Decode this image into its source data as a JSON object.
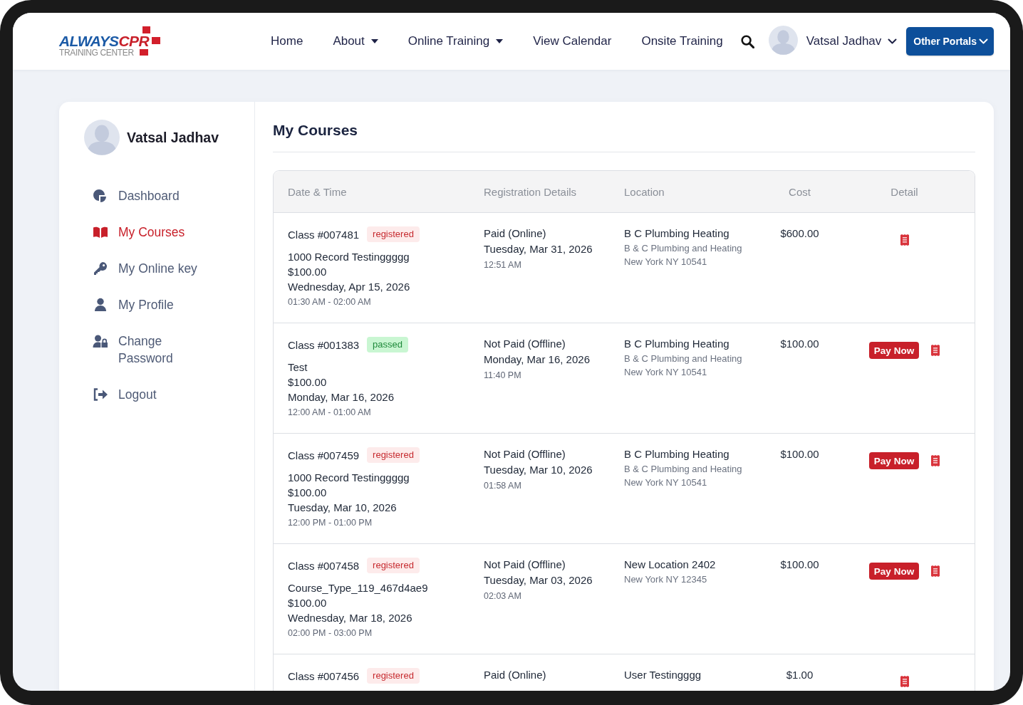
{
  "header": {
    "logo": {
      "brand_first": "ALWAYS",
      "brand_second": "CPR",
      "tagline": "TRAINING CENTER"
    },
    "nav": [
      {
        "label": "Home",
        "has_menu": false
      },
      {
        "label": "About",
        "has_menu": true
      },
      {
        "label": "Online Training",
        "has_menu": true
      },
      {
        "label": "View Calendar",
        "has_menu": false
      },
      {
        "label": "Onsite Training",
        "has_menu": false
      }
    ],
    "user_menu": {
      "name": "Vatsal Jadhav"
    },
    "portals_button": "Other Portals"
  },
  "sidebar": {
    "user_name": "Vatsal Jadhav",
    "items": [
      {
        "label": "Dashboard",
        "kind": "dashboard",
        "selected": false
      },
      {
        "label": "My Courses",
        "kind": "courses",
        "selected": true
      },
      {
        "label": "My Online key",
        "kind": "key",
        "selected": false
      },
      {
        "label": "My Profile",
        "kind": "profile",
        "selected": false
      },
      {
        "label": "Change Password",
        "kind": "password",
        "selected": false
      },
      {
        "label": "Logout",
        "kind": "logout",
        "selected": false
      }
    ]
  },
  "main": {
    "title": "My Courses",
    "table": {
      "columns": [
        "Date & Time",
        "Registration Details",
        "Location",
        "Cost",
        "Detail"
      ],
      "rows": [
        {
          "class_number": "Class #007481",
          "status": {
            "label": "registered",
            "kind": "registered"
          },
          "course": "1000 Record Testinggggg",
          "price": "$100.00",
          "class_date": "Wednesday, Apr 15, 2026",
          "class_time": "01:30 AM - 02:00 AM",
          "payment_status": "Paid (Online)",
          "registration_date": "Tuesday, Mar 31, 2026",
          "registration_time": "12:51 AM",
          "location_name": "B C Plumbing Heating",
          "location_lines": [
            "B & C Plumbing and Heating",
            "New York NY 10541"
          ],
          "cost": "$600.00"
        },
        {
          "class_number": "Class #001383",
          "status": {
            "label": "passed",
            "kind": "passed"
          },
          "course": "Test",
          "price": "$100.00",
          "class_date": "Monday, Mar 16, 2026",
          "class_time": "12:00 AM - 01:00 AM",
          "payment_status": "Not Paid (Offline)",
          "registration_date": "Monday, Mar 16, 2026",
          "registration_time": "11:40 PM",
          "location_name": "B C Plumbing Heating",
          "location_lines": [
            "B & C Plumbing and Heating",
            "New York NY 10541"
          ],
          "cost": "$100.00",
          "pay_button": "Pay Now"
        },
        {
          "class_number": "Class #007459",
          "status": {
            "label": "registered",
            "kind": "registered"
          },
          "course": "1000 Record Testinggggg",
          "price": "$100.00",
          "class_date": "Tuesday, Mar 10, 2026",
          "class_time": "12:00 PM - 01:00 PM",
          "payment_status": "Not Paid (Offline)",
          "registration_date": "Tuesday, Mar 10, 2026",
          "registration_time": "01:58 AM",
          "location_name": "B C Plumbing Heating",
          "location_lines": [
            "B & C Plumbing and Heating",
            "New York NY 10541"
          ],
          "cost": "$100.00",
          "pay_button": "Pay Now"
        },
        {
          "class_number": "Class #007458",
          "status": {
            "label": "registered",
            "kind": "registered"
          },
          "course": "Course_Type_119_467d4ae9",
          "price": "$100.00",
          "class_date": "Wednesday, Mar 18, 2026",
          "class_time": "02:00 PM - 03:00 PM",
          "payment_status": "Not Paid (Offline)",
          "registration_date": "Tuesday, Mar 03, 2026",
          "registration_time": "02:03 AM",
          "location_name": "New Location 2402",
          "location_lines": [
            "New York NY 12345"
          ],
          "cost": "$100.00",
          "pay_button": "Pay Now"
        },
        {
          "class_number": "Class #007456",
          "status": {
            "label": "registered",
            "kind": "registered"
          },
          "payment_status": "Paid (Online)",
          "location_name": "User Testingggg",
          "cost": "$1.00"
        }
      ]
    }
  }
}
